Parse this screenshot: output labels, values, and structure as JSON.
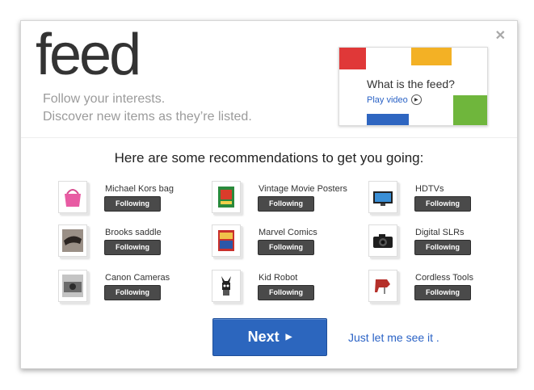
{
  "dialog": {
    "close_glyph": "✕",
    "logo": "feed",
    "tagline_1": "Follow your interests.",
    "tagline_2": "Discover new items as they’re listed.",
    "promo": {
      "question": "What is the feed?",
      "link": "Play video",
      "colors": {
        "red": "#e03838",
        "yellow": "#f3b125",
        "green": "#6fb63c",
        "blue": "#2f66c1"
      }
    },
    "heading": "Here are some recommendations to get you going:",
    "items": [
      {
        "label": "Michael Kors bag",
        "button": "Following",
        "icon": "handbag-icon"
      },
      {
        "label": "Vintage Movie Posters",
        "button": "Following",
        "icon": "poster-icon"
      },
      {
        "label": "HDTVs",
        "button": "Following",
        "icon": "tv-icon"
      },
      {
        "label": "Brooks saddle",
        "button": "Following",
        "icon": "saddle-icon"
      },
      {
        "label": "Marvel Comics",
        "button": "Following",
        "icon": "comic-icon"
      },
      {
        "label": "Digital SLRs",
        "button": "Following",
        "icon": "dslr-camera-icon"
      },
      {
        "label": "Canon Cameras",
        "button": "Following",
        "icon": "camera-icon"
      },
      {
        "label": "Kid Robot",
        "button": "Following",
        "icon": "toy-figure-icon"
      },
      {
        "label": "Cordless Tools",
        "button": "Following",
        "icon": "jigsaw-tool-icon"
      }
    ],
    "next_label": "Next",
    "next_arrow": "▶",
    "skip_label": "Just let me see it ."
  }
}
